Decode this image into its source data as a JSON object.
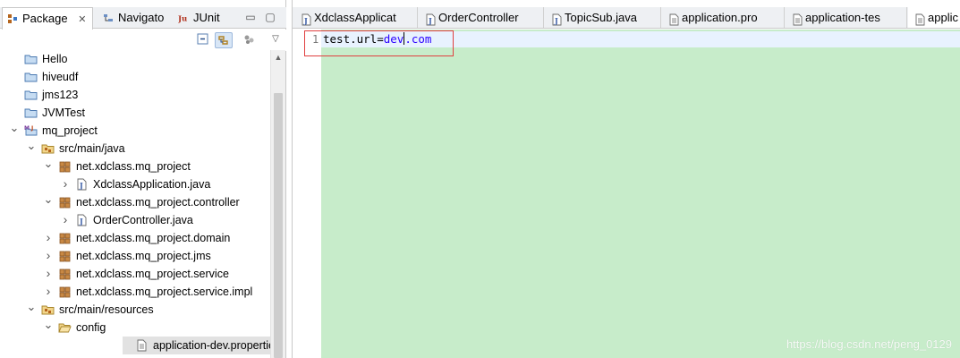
{
  "left_tabs": [
    {
      "label": "Package",
      "active": true
    },
    {
      "label": "Navigato"
    },
    {
      "label": "JUnit"
    }
  ],
  "left_tab_close": "✕",
  "window_controls": {
    "minimize": "▭",
    "maximize": "▢"
  },
  "tree": [
    {
      "label": "Hello",
      "icon": "folder-icon",
      "depth": 0
    },
    {
      "label": "hiveudf",
      "icon": "folder-icon",
      "depth": 0
    },
    {
      "label": "jms123",
      "icon": "folder-icon",
      "depth": 0
    },
    {
      "label": "JVMTest",
      "icon": "folder-icon",
      "depth": 0
    },
    {
      "label": "mq_project",
      "icon": "maven-project-icon",
      "depth": 0,
      "expanded": true
    },
    {
      "label": "src/main/java",
      "icon": "source-folder-icon",
      "depth": 1,
      "expanded": true
    },
    {
      "label": "net.xdclass.mq_project",
      "icon": "package-icon",
      "depth": 2,
      "expanded": true
    },
    {
      "label": "XdclassApplication.java",
      "icon": "java-file-icon",
      "depth": 3,
      "collapsed": true
    },
    {
      "label": "net.xdclass.mq_project.controller",
      "icon": "package-icon",
      "depth": 2,
      "expanded": true
    },
    {
      "label": "OrderController.java",
      "icon": "java-file-icon",
      "depth": 3,
      "collapsed": true
    },
    {
      "label": "net.xdclass.mq_project.domain",
      "icon": "package-icon",
      "depth": 2,
      "collapsed": true
    },
    {
      "label": "net.xdclass.mq_project.jms",
      "icon": "package-icon",
      "depth": 2,
      "collapsed": true
    },
    {
      "label": "net.xdclass.mq_project.service",
      "icon": "package-icon",
      "depth": 2,
      "collapsed": true
    },
    {
      "label": "net.xdclass.mq_project.service.impl",
      "icon": "package-icon",
      "depth": 2,
      "collapsed": true
    },
    {
      "label": "src/main/resources",
      "icon": "source-folder-icon",
      "depth": 1,
      "expanded": true
    },
    {
      "label": "config",
      "icon": "open-folder-icon",
      "depth": 2,
      "expanded": true
    },
    {
      "label": "application-dev.properties",
      "icon": "properties-file-icon",
      "depth": 3,
      "selected": true
    }
  ],
  "editor_tabs": [
    {
      "label": "XdclassApplicat",
      "icon": "java-file-icon"
    },
    {
      "label": "OrderController",
      "icon": "java-file-icon"
    },
    {
      "label": "TopicSub.java",
      "icon": "java-file-icon"
    },
    {
      "label": "application.pro",
      "icon": "properties-file-icon"
    },
    {
      "label": "application-tes",
      "icon": "properties-file-icon"
    },
    {
      "label": "applic",
      "icon": "properties-file-icon",
      "active": true
    }
  ],
  "editor": {
    "line_number": "1",
    "code_key": "test.url=",
    "code_value_before_caret": "dev",
    "code_value_after_caret": ".com"
  },
  "watermark": "https://blog.csdn.net/peng_0129",
  "colors": {
    "editor_background": "#c7ecca",
    "highlight_box": "#e04040",
    "property_value": "#2a00ff",
    "selection": "#e2e2e2"
  }
}
